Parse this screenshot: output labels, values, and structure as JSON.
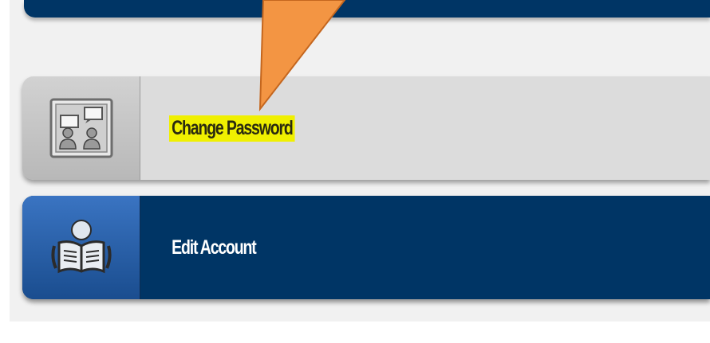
{
  "menu": {
    "items": [
      {
        "label": "Change Password",
        "icon": "presentation-board-icon",
        "highlighted": true
      },
      {
        "label": "Edit Account",
        "icon": "reading-user-icon",
        "highlighted": false
      }
    ]
  },
  "colors": {
    "navy": "#003565",
    "gray_item": "#dcdcdc",
    "highlight": "#f0f000",
    "callout_arrow": "#f39543"
  }
}
